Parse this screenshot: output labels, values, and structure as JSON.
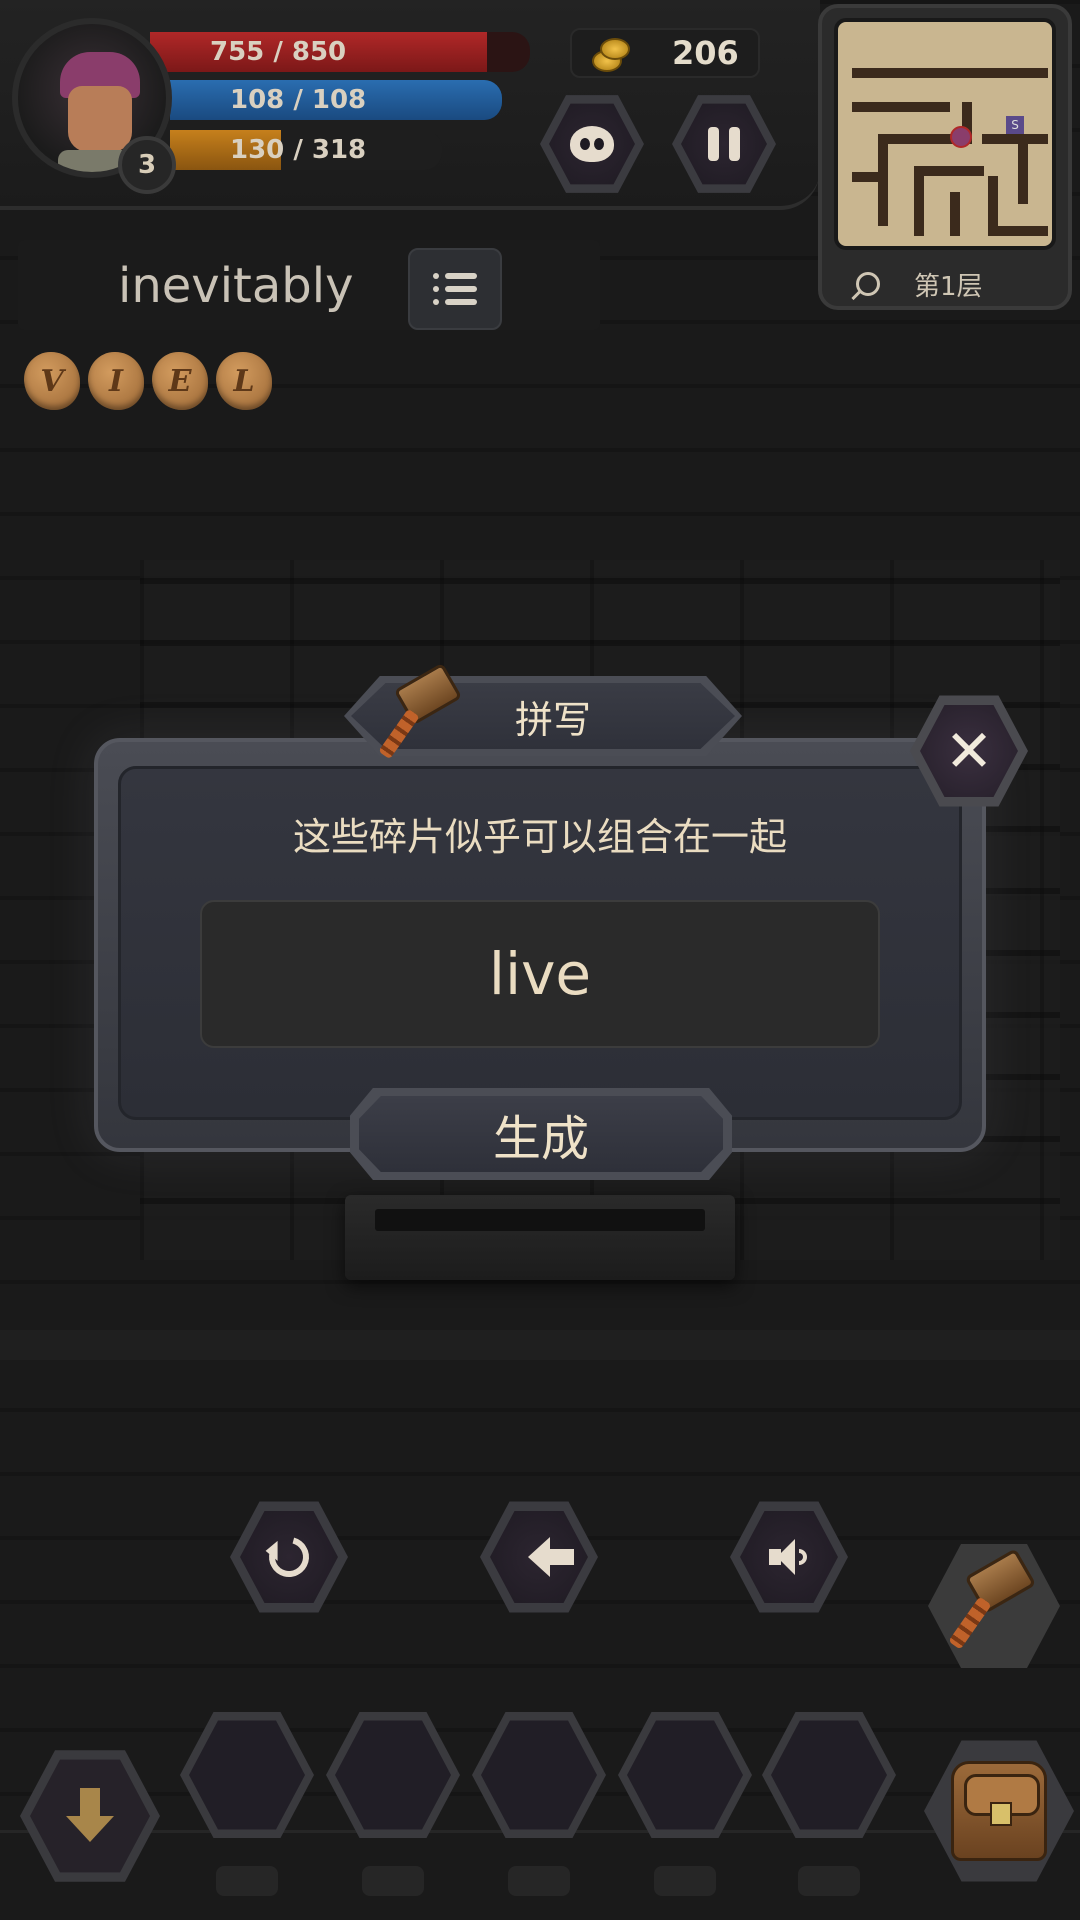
{
  "hud": {
    "level": "3",
    "hp_text": "755 / 850",
    "hp_fraction": 0.888,
    "mp_text": "108 / 108",
    "mp_fraction": 1.0,
    "xp_text": "130 / 318",
    "xp_fraction": 0.409,
    "gold": "206",
    "floor_label": "第1层"
  },
  "word": {
    "target": "inevitably",
    "fragments": [
      "V",
      "I",
      "E",
      "L"
    ]
  },
  "dialog": {
    "title": "拼写",
    "hint": "这些碎片似乎可以组合在一起",
    "spelled": "live",
    "generate_label": "生成",
    "close_glyph": "✕"
  },
  "icons": {
    "coin": "coin-icon",
    "pet": "pet-icon",
    "pause": "pause-icon",
    "list": "list-icon",
    "hammer": "hammer-icon",
    "reset": "refresh-icon",
    "back": "arrow-left-icon",
    "sound": "speaker-icon",
    "drop": "arrow-down-icon",
    "bag": "backpack-icon"
  },
  "colors": {
    "hp": "#b02828",
    "mp": "#2a6db0",
    "xp": "#c6801c",
    "text_cream": "#eadcc1",
    "panel": "#34363f"
  }
}
